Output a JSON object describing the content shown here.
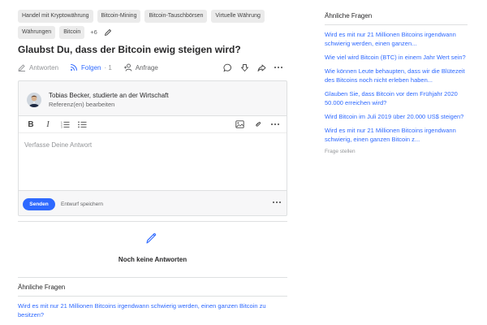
{
  "topics": [
    "Handel mit Kryptowährung",
    "Bitcoin-Mining",
    "Bitcoin-Tauschbörsen",
    "Virtuelle Währung",
    "Währungen",
    "Bitcoin"
  ],
  "topics_more": "+6",
  "question": {
    "title": "Glaubst Du, dass der Bitcoin ewig steigen wird?"
  },
  "actions": {
    "answer_label": "Antworten",
    "follow_label": "Folgen",
    "follow_count": "· 1",
    "request_label": "Anfrage"
  },
  "author": {
    "name": "Tobias Becker, studierte an der Wirtschaft",
    "credentials_link": "Referenz(en) bearbeiten"
  },
  "editor": {
    "bold": "B",
    "italic": "I",
    "placeholder": "Verfasse Deine Antwort"
  },
  "footer": {
    "send_label": "Senden",
    "draft_label": "Entwurf speichern"
  },
  "empty_state": {
    "text": "Noch keine Antworten"
  },
  "related_bottom": {
    "title": "Ähnliche Fragen",
    "links": [
      "Wird es mit nur 21 Millionen Bitcoins irgendwann schwierig werden, einen ganzen Bitcoin zu besitzen?"
    ]
  },
  "sidebar": {
    "title": "Ähnliche Fragen",
    "links": [
      "Wird es mit nur 21 Millionen Bitcoins irgendwann schwierig werden, einen ganzen...",
      "Wie viel wird Bitcoin (BTC) in einem Jahr Wert sein?",
      "Wie können Leute behaupten, dass wir die Blütezeit des Bitcoins noch nicht erleben haben...",
      "Glauben Sie, dass Bitcoin vor dem Frühjahr 2020 50.000 erreichen wird?",
      "Wird Bitcoin im Juli 2019 über 20.000 US$ steigen?",
      "Wird es mit nur 21 Millionen Bitcoins irgendwann schwierig, einen ganzen Bitcoin z..."
    ],
    "ask_label": "Frage stellen"
  },
  "colors": {
    "accent": "#2e69ff",
    "text": "#282829",
    "muted": "#939598",
    "chip": "#ebebeb",
    "panel": "#f7f7f8"
  }
}
